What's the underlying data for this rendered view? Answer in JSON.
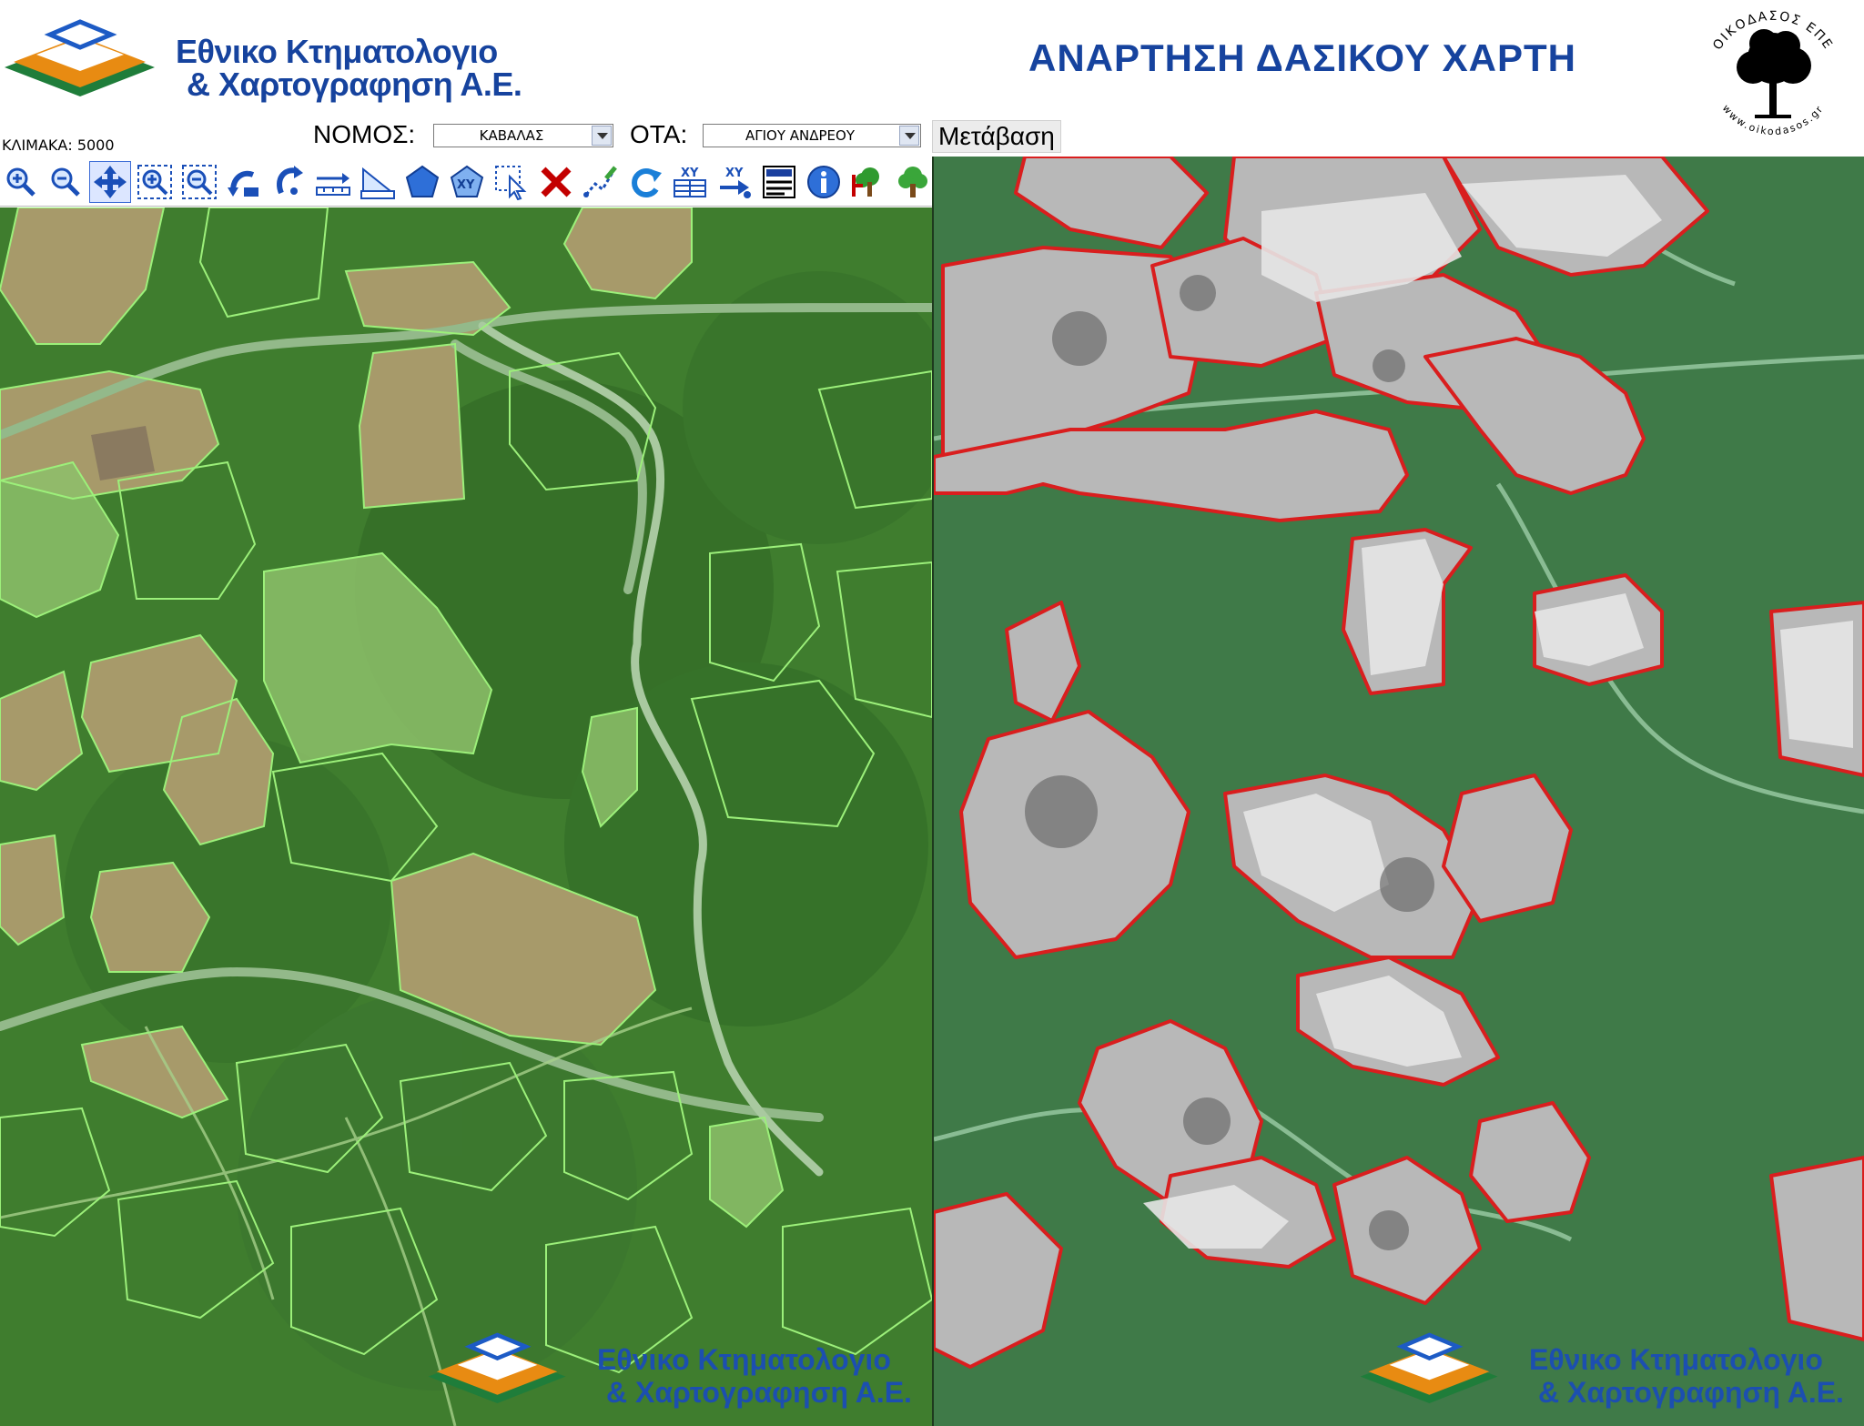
{
  "header": {
    "org_name_line1": "Εθνικο Κτηματολογιο",
    "org_name_line2": "& Χαρτογραφηση Α.Ε.",
    "page_title": "ΑΝΑΡΤΗΣΗ ΔΑΣΙΚΟΥ ΧΑΡΤΗ",
    "partner_name": "ΟΙΚΟΔΑΣΟΣ ΕΠΕ",
    "partner_url": "www.oikodasos.gr"
  },
  "controls": {
    "scale_label": "ΚΛΙΜΑΚΑ: 5000",
    "nomos_label": "ΝΟΜΟΣ:",
    "nomos_value": "ΚΑΒΑΛΑΣ",
    "ota_label": "ΟΤΑ:",
    "ota_value": "ΑΓΙΟΥ ΑΝΔΡΕΟΥ",
    "go_button": "Μετάβαση"
  },
  "toolbar": {
    "tools": [
      "zoom-in-icon",
      "zoom-out-icon",
      "pan-icon",
      "zoom-box-in-icon",
      "zoom-box-out-icon",
      "previous-view-icon",
      "next-view-icon",
      "measure-distance-icon",
      "measure-area-icon",
      "polygon-icon",
      "xy-locate-icon",
      "select-icon",
      "clear-icon",
      "edit-icon",
      "refresh-icon",
      "xy-table-icon",
      "xy-goto-icon",
      "legend-icon",
      "info-icon",
      "forest-map-icon",
      "tree-icon",
      "brush-icon"
    ]
  },
  "watermark": {
    "line1": "Εθνικο Κτηματολογιο",
    "line2": "& Χαρτογραφηση Α.Ε."
  },
  "colors": {
    "brand_blue": "#16439e",
    "parcel_outline": "#9cf07a",
    "forest_outline": "#d91e1e",
    "forest_fill": "#3f7a48"
  }
}
